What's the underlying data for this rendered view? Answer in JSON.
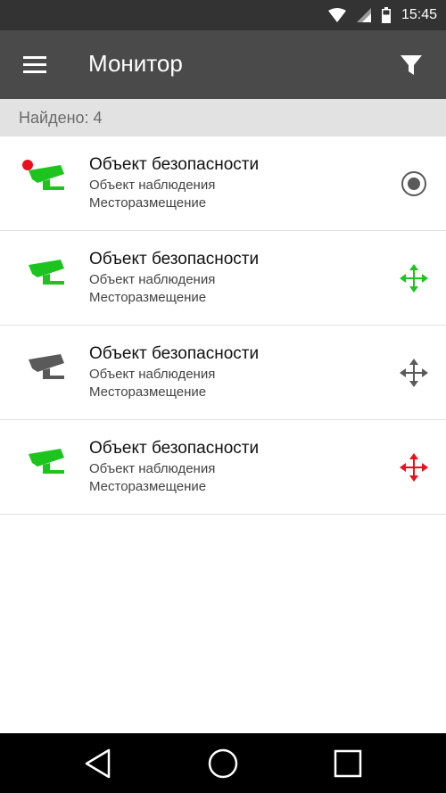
{
  "status_bar": {
    "time": "15:45",
    "icons": [
      "wifi-icon",
      "signal-icon",
      "battery-icon"
    ]
  },
  "app_bar": {
    "title": "Монитор",
    "menu_icon": "menu-icon",
    "filter_icon": "filter-icon"
  },
  "found": {
    "label": "Найдено: 4"
  },
  "colors": {
    "status_bar": "#333333",
    "app_bar": "#4a4a4a",
    "found_bar": "#e2e2e2",
    "camera_green": "#1ec41e",
    "camera_gray": "#5a5a5a",
    "arrows_red": "#e8101c",
    "record_dot": "#e8101c"
  },
  "items": [
    {
      "title": "Объект безопасности",
      "subtitle": "Объект наблюдения",
      "place": "Месторазмещение",
      "camera_icon": "camera-icon",
      "camera_color": "green",
      "recording": true,
      "action_icon": "radio-selected-icon"
    },
    {
      "title": "Объект безопасности",
      "subtitle": "Объект наблюдения",
      "place": "Месторазмещение",
      "camera_icon": "camera-icon",
      "camera_color": "green",
      "recording": false,
      "action_icon": "move-arrows-icon",
      "action_color": "green"
    },
    {
      "title": "Объект безопасности",
      "subtitle": "Объект наблюдения",
      "place": "Месторазмещение",
      "camera_icon": "camera-icon",
      "camera_color": "gray",
      "recording": false,
      "action_icon": "move-arrows-icon",
      "action_color": "gray"
    },
    {
      "title": "Объект безопасности",
      "subtitle": "Объект наблюдения",
      "place": "Месторазмещение",
      "camera_icon": "camera-icon",
      "camera_color": "green",
      "recording": false,
      "action_icon": "move-arrows-icon",
      "action_color": "red"
    }
  ],
  "nav_bar": {
    "icons": [
      "back-icon",
      "home-icon",
      "recents-icon"
    ]
  }
}
